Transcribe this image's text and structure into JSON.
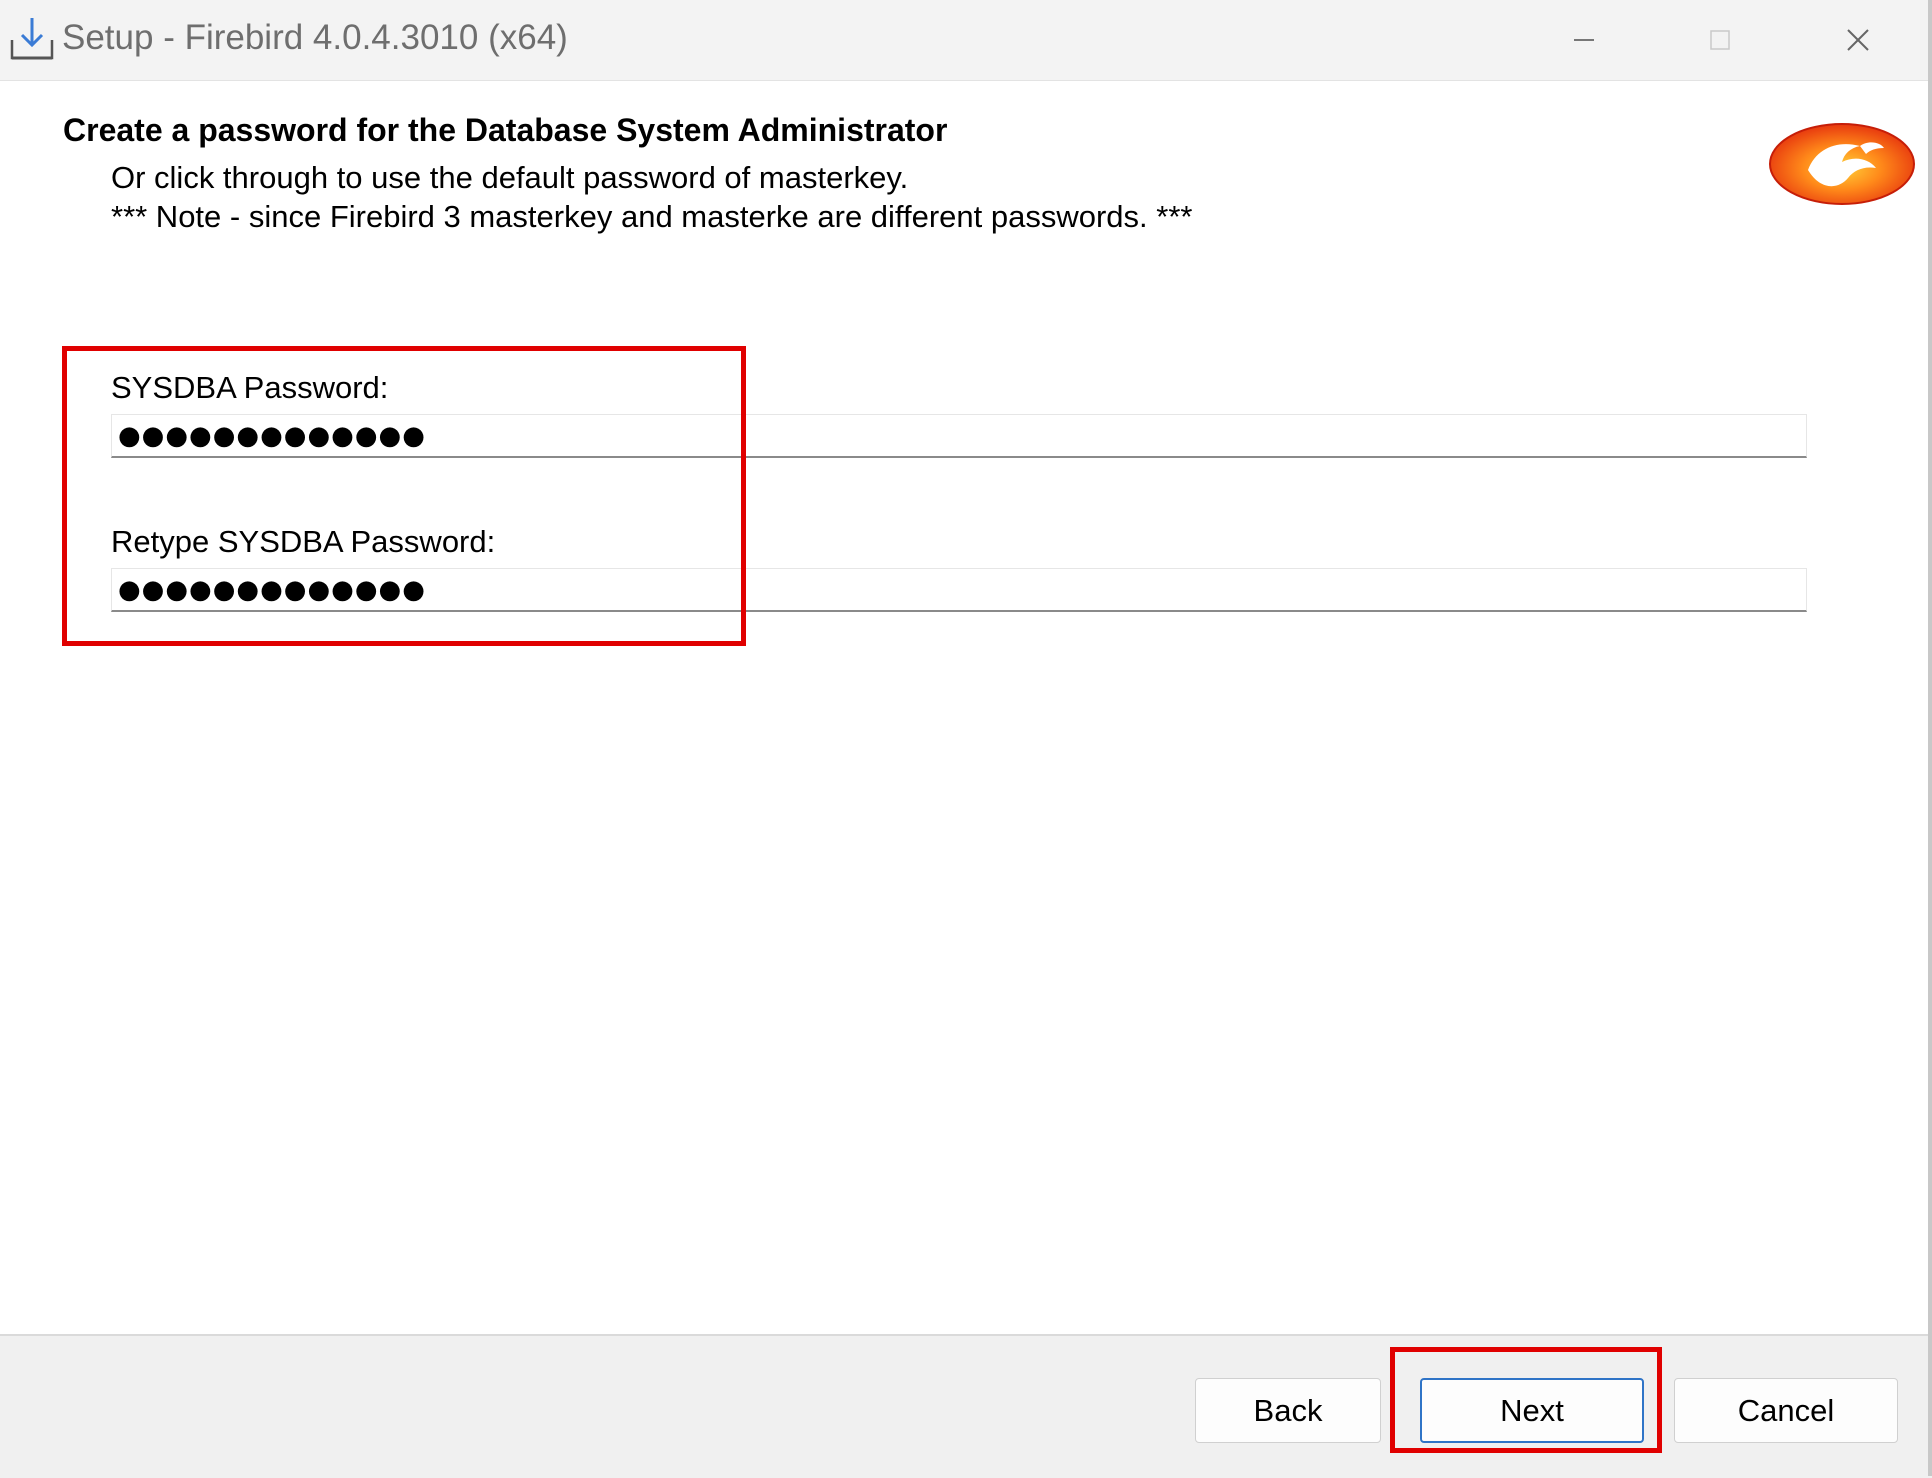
{
  "window": {
    "title": "Setup - Firebird 4.0.4.3010 (x64)"
  },
  "header": {
    "heading": "Create a password for the Database System Administrator",
    "line1": "Or click through to use the default password of masterkey.",
    "line2": "*** Note - since Firebird 3 masterkey and masterke are different passwords. ***"
  },
  "form": {
    "password_label": "SYSDBA Password:",
    "password_value": "●●●●●●●●●●●●●",
    "retype_label": "Retype SYSDBA Password:",
    "retype_value": "●●●●●●●●●●●●●"
  },
  "buttons": {
    "back": "Back",
    "next": "Next",
    "cancel": "Cancel"
  },
  "colors": {
    "highlight": "#e00000",
    "default_button_border": "#2f74c7"
  },
  "icons": {
    "app": "download-icon",
    "logo": "firebird-logo",
    "minimize": "minimize-icon",
    "maximize": "maximize-icon",
    "close": "close-icon"
  }
}
